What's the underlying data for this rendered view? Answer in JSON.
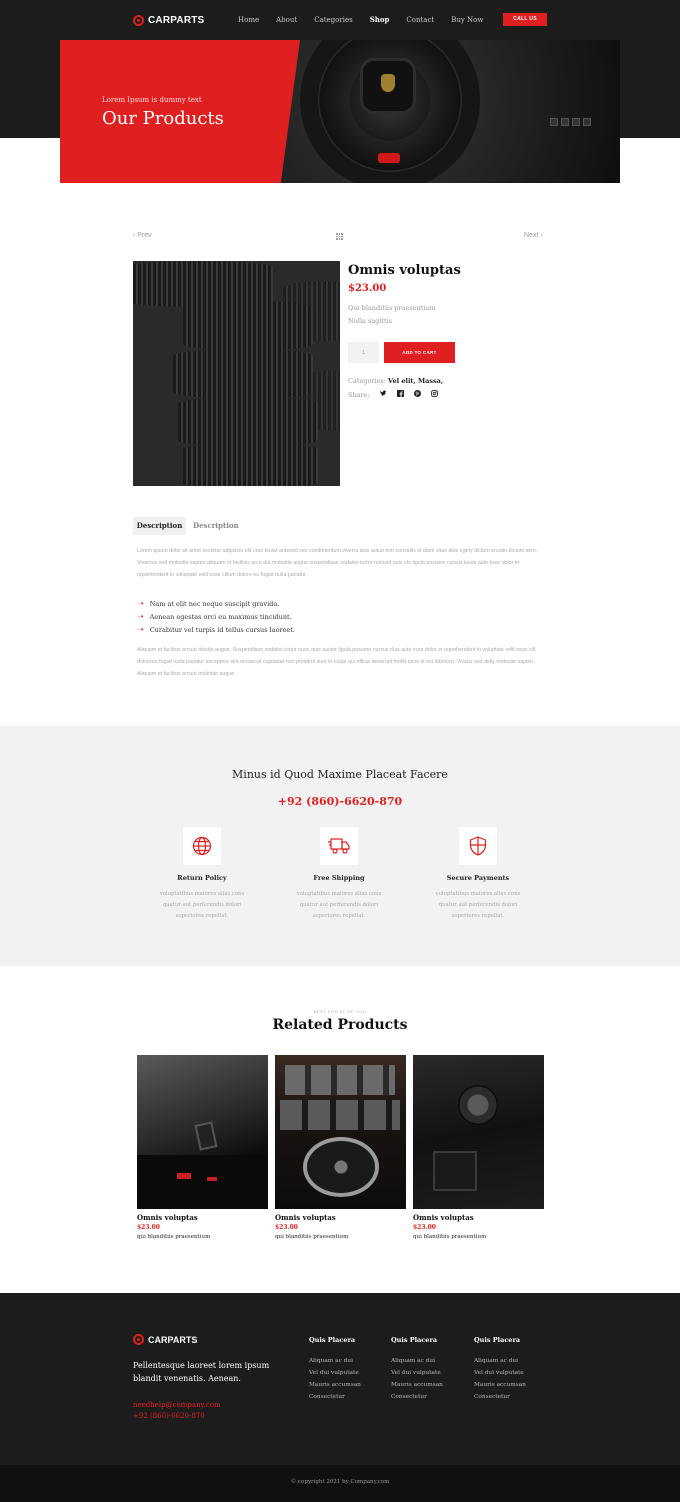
{
  "brand": {
    "name": "CARPARTS",
    "call_label": "CALL US"
  },
  "nav": [
    "Home",
    "About",
    "Categories",
    "Shop",
    "Contact",
    "Buy Now"
  ],
  "hero": {
    "subtitle": "Lorem Ipsum is dummy text",
    "title": "Our Products"
  },
  "pager": {
    "prev": "‹ Prev",
    "next": "Next ›"
  },
  "product": {
    "name": "Omnis voluptas",
    "price": "$23.00",
    "desc_line1": "Qui blanditiis praesentium",
    "desc_line2": "Nulla sagittis",
    "qty": "1",
    "add_to_cart": "ADD TO CART",
    "categories_label": "Categories:",
    "categories_value": "Vel elit, Massa,",
    "share_label": "Share:",
    "share_icons": [
      "twitter-icon",
      "facebook-icon",
      "pinterest-icon",
      "instagram-icon"
    ]
  },
  "tabs": [
    "Description",
    "Description"
  ],
  "description": {
    "para1": "Lorem ipsum dolor sit amet sectetur adipiscin elit cras feuiat antesed ces condimentum viverra duis autue nim convallis id diam vitae duis egety dictum erostin dictum sem. Vivamus sed molestie sapien aliquam et facilisis arcu dut molestie augue suspendisse sodales tortor nunced quis cto ligula posuere cursus keuis aute irure dolor in reprehenderit in voluptate velit esse cillum dolore eu fugiat nulla pariatur.",
    "bullets": [
      "Nam at elit nec neque suscipit gravida.",
      "Aenean egestas orci eu maximus tincidunt.",
      "Curabitur vel turpis id tellus cursus laoreet."
    ],
    "para2": "Aliquam et facilisis arcuut olestie augue. Suspendisse sodales tortor nunc quis auctor ligula posuere cursus duis aute irure dolor in reprehenderit in voluptate velit esse cill doloreeu fugiat nulla pariatur excepteur sint occaecat cupidatat non proident sunt in culpa qui officia deserunt mollit anim id est laborum. Vivaus sed delly molestie sapien. Aliquam et facilisis arcuut molestie augue."
  },
  "info": {
    "title": "Minus id Quod Maxime Placeat Facere",
    "phone": "+92 (860)-6620-870",
    "features": [
      {
        "icon": "globe-icon",
        "title": "Return Policy",
        "lines": [
          "voluptatibus maiores alias cons",
          "quatur aut perferendis dolori",
          "asperiores repellat."
        ]
      },
      {
        "icon": "delivery-truck-icon",
        "title": "Free Shipping",
        "lines": [
          "voluptatibus maiores alias cons",
          "quatur aut perferendis dolori",
          "asperiores repellat."
        ]
      },
      {
        "icon": "shield-icon",
        "title": "Secure Payments",
        "lines": [
          "voluptatibus maiores alias cons",
          "quatur aut perferendis dolori",
          "asperiores repellat."
        ]
      }
    ]
  },
  "related": {
    "eyebrow": "BEST FOR AL OF YOU",
    "title": "Related Products",
    "items": [
      {
        "name": "Omnis voluptas",
        "price": "$23.00",
        "desc": "qui blanditiis praesentium"
      },
      {
        "name": "Omnis voluptas",
        "price": "$23.00",
        "desc": "qui blanditiis praesentium"
      },
      {
        "name": "Omnis voluptas",
        "price": "$23.00",
        "desc": "qui blanditiis praesentium"
      }
    ]
  },
  "footer": {
    "tagline": "Pellentesque laoreet lorem ipsum blandit venenatis. Aenean.",
    "email": "needhelp@company.com",
    "phone": "+92 (860)-6620-870",
    "columns": [
      {
        "title": "Quis Placera",
        "links": [
          "Aliquam ac dui",
          "Vel dui vulputate",
          "Mauris accumsan",
          "Consectetur"
        ]
      },
      {
        "title": "Quis Placera",
        "links": [
          "Aliquam ac dui",
          "Vel dui vulputate",
          "Mauris accumsan",
          "Consectetur"
        ]
      },
      {
        "title": "Quis Placera",
        "links": [
          "Aliquam ac dui",
          "Vel dui vulputate",
          "Mauris accumsan",
          "Consectetur"
        ]
      }
    ],
    "copyright": "© copyright 2021 by Company.com"
  },
  "colors": {
    "accent": "#e02020",
    "dark": "#1c1c1c",
    "band": "#f2f2f2"
  }
}
